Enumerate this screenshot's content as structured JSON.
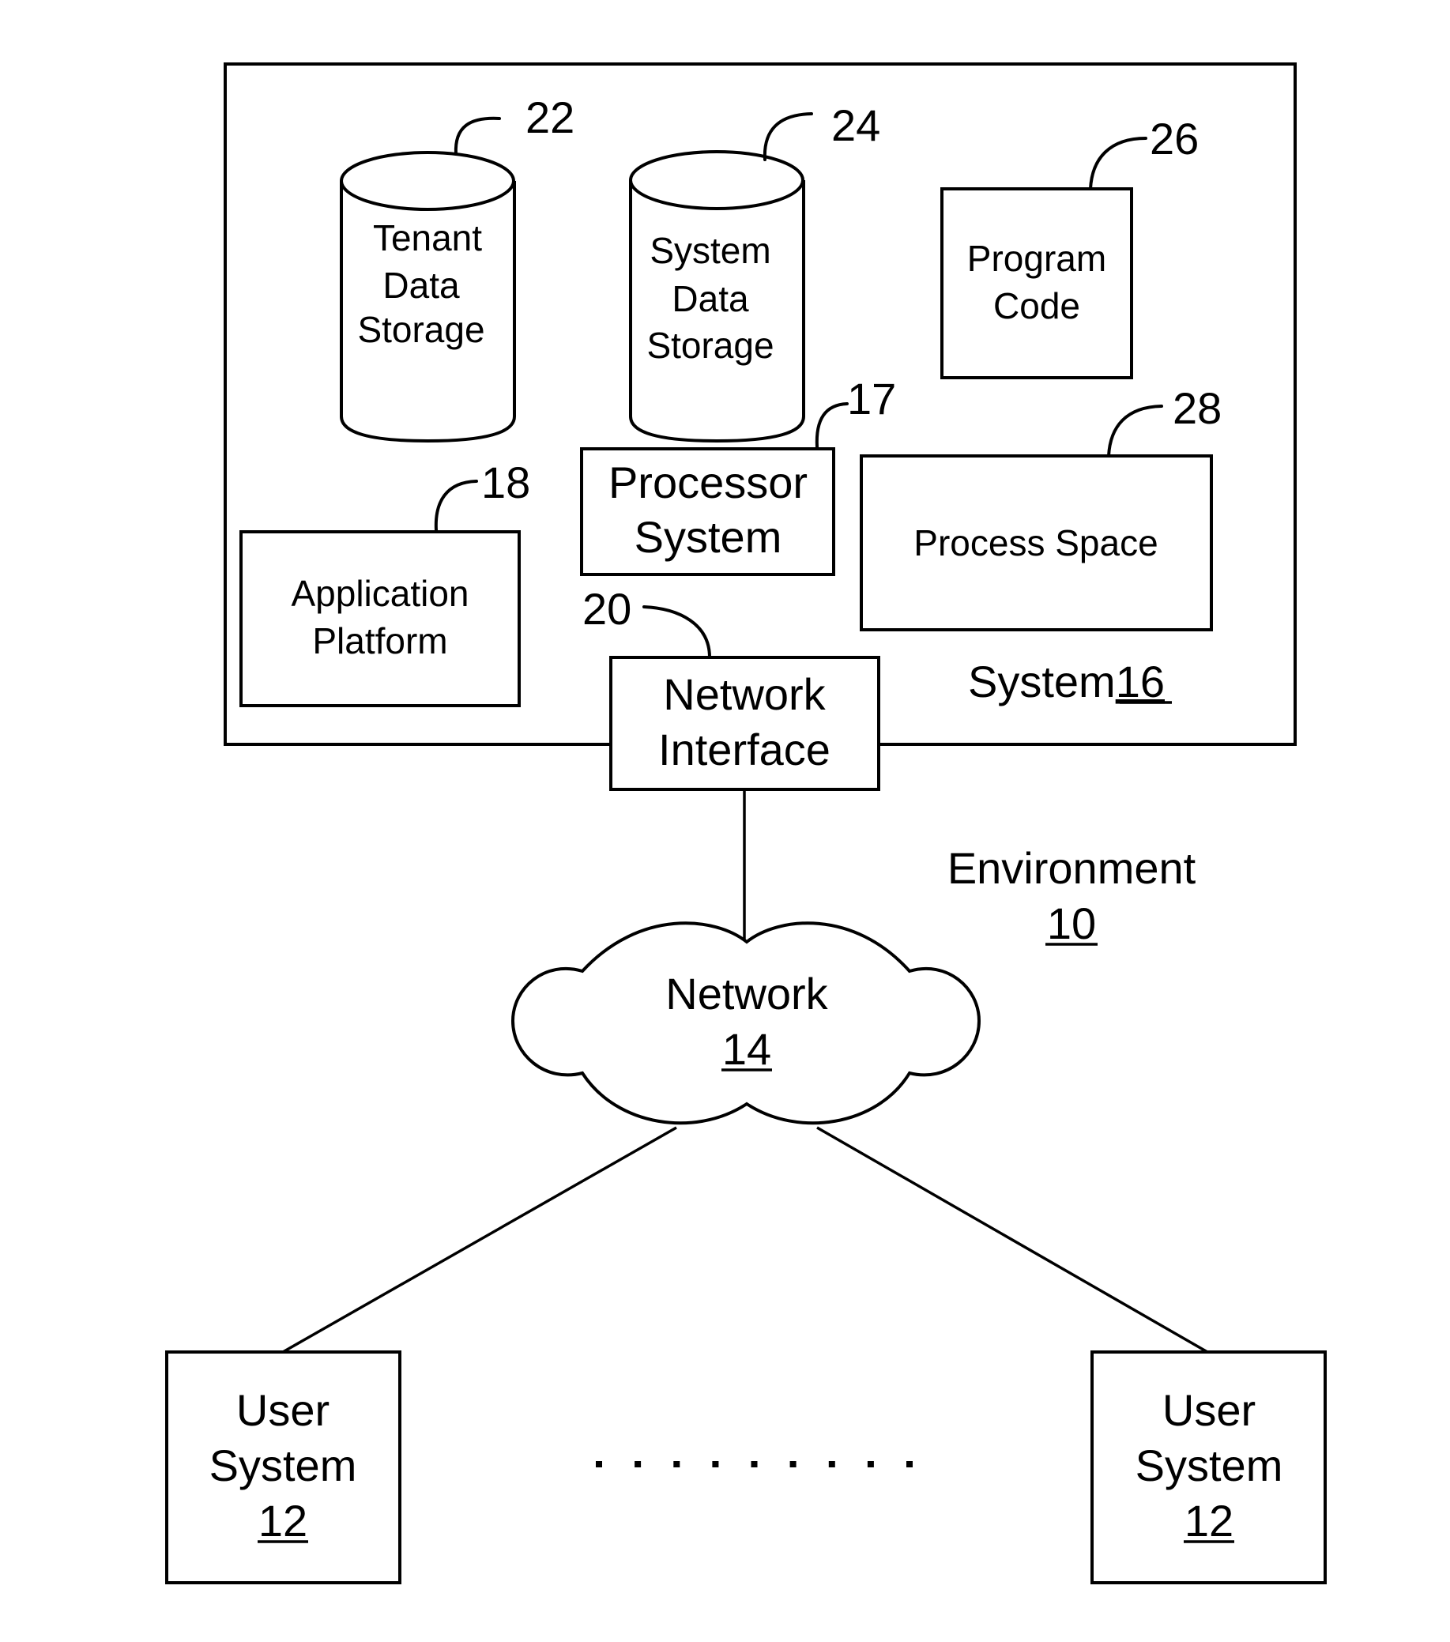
{
  "figure": {
    "environment": {
      "label": "Environment",
      "ref": "10"
    },
    "system": {
      "label": "System",
      "ref": "16"
    },
    "components": {
      "tenant_data_storage": {
        "lines": [
          "Tenant",
          "Data",
          "Storage"
        ],
        "ref": "22"
      },
      "system_data_storage": {
        "lines": [
          "System",
          "Data",
          "Storage"
        ],
        "ref": "24"
      },
      "program_code": {
        "lines": [
          "Program",
          "Code"
        ],
        "ref": "26"
      },
      "processor_system": {
        "lines": [
          "Processor",
          "System"
        ],
        "ref": "17"
      },
      "process_space": {
        "lines": [
          "Process Space"
        ],
        "ref": "28"
      },
      "application_platform": {
        "lines": [
          "Application",
          "Platform"
        ],
        "ref": "18"
      },
      "network_interface": {
        "lines": [
          "Network",
          "Interface"
        ],
        "ref": "20"
      }
    },
    "network": {
      "label": "Network",
      "ref": "14"
    },
    "user_systems": [
      {
        "lines": [
          "User",
          "System"
        ],
        "ref": "12"
      },
      {
        "lines": [
          "User",
          "System"
        ],
        "ref": "12"
      }
    ],
    "ellipsis_dot_count": 9
  }
}
